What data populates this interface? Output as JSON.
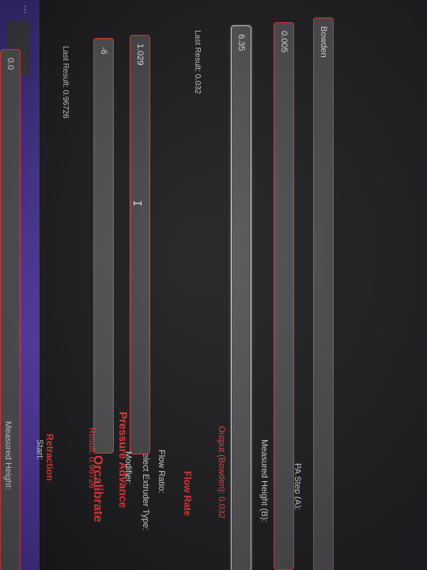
{
  "app": {
    "title": "Orcalibrate",
    "section_pa": "Pressure Advance"
  },
  "pressure_advance": {
    "extruder_type_label": "Select Extruder Type:",
    "extruder_type_value": "Bowden",
    "pa_step_label": "PA Step (A):",
    "pa_step_value": "0.005",
    "measured_height_label": "Measured Height (B):",
    "measured_height_value": "6.35",
    "output_text": "Output (Bowden): 0.032",
    "last_result": "Last Result: 0.032"
  },
  "flow_rate": {
    "section": "Flow Rate",
    "flow_ratio_label": "Flow Ratio:",
    "flow_ratio_value": "1.029",
    "modifier_label": "Modifier:",
    "modifier_value": "-6",
    "result_text": "Result: 0.96726",
    "last_result": "Last Result: 0.96726"
  },
  "retraction": {
    "section": "Retraction",
    "start_label": "Start:",
    "start_value": "0.0",
    "measured_height_label": "Measured Height:"
  },
  "colors": {
    "accent": "#ff3a3a",
    "field_bg": "#535356",
    "page_bg": "#202023",
    "browser_chrome": "#5b3fb0"
  }
}
